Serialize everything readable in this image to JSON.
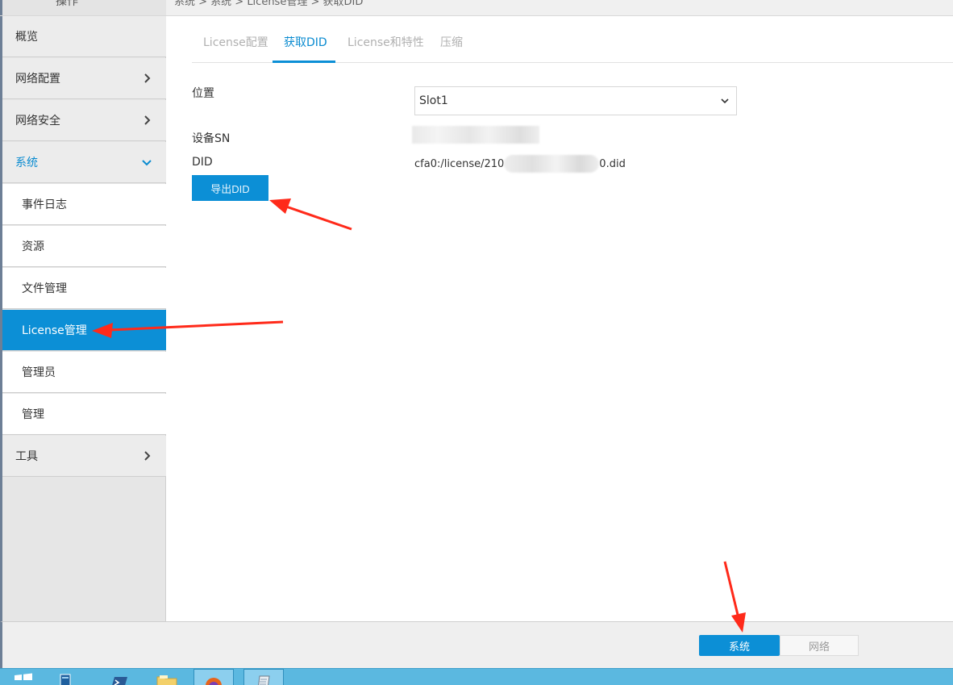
{
  "top": {
    "section_title": "操作",
    "breadcrumb": "系统 > 系统 > License管理 > 获取DID"
  },
  "sidebar": {
    "items": [
      {
        "label": "概览"
      },
      {
        "label": "网络配置"
      },
      {
        "label": "网络安全"
      },
      {
        "label": "系统",
        "expanded": true
      },
      {
        "label": "工具"
      }
    ],
    "system_children": [
      {
        "label": "事件日志"
      },
      {
        "label": "资源"
      },
      {
        "label": "文件管理"
      },
      {
        "label": "License管理",
        "selected": true
      },
      {
        "label": "管理员"
      },
      {
        "label": "管理"
      }
    ]
  },
  "tabs": [
    {
      "label": "License配置"
    },
    {
      "label": "获取DID",
      "active": true
    },
    {
      "label": "License和特性"
    },
    {
      "label": "压缩"
    }
  ],
  "form": {
    "location_label": "位置",
    "location_value": "Slot1",
    "sn_label": "设备SN",
    "did_label": "DID",
    "did_path_prefix": "cfa0:/license/210",
    "did_path_suffix": "0.did",
    "export_button": "导出DID"
  },
  "bottom": {
    "system_button": "系统",
    "network_button": "网络"
  },
  "taskbar": {
    "icons": [
      "windows-start-icon",
      "server-manager-icon",
      "powershell-icon",
      "file-explorer-icon",
      "firefox-icon",
      "notepad-icon"
    ]
  },
  "colors": {
    "accent": "#0c8fd6",
    "annotation_arrow": "#ff2a1a",
    "sidebar_bg": "#e6e6e6",
    "taskbar": "#5bb8e0"
  }
}
